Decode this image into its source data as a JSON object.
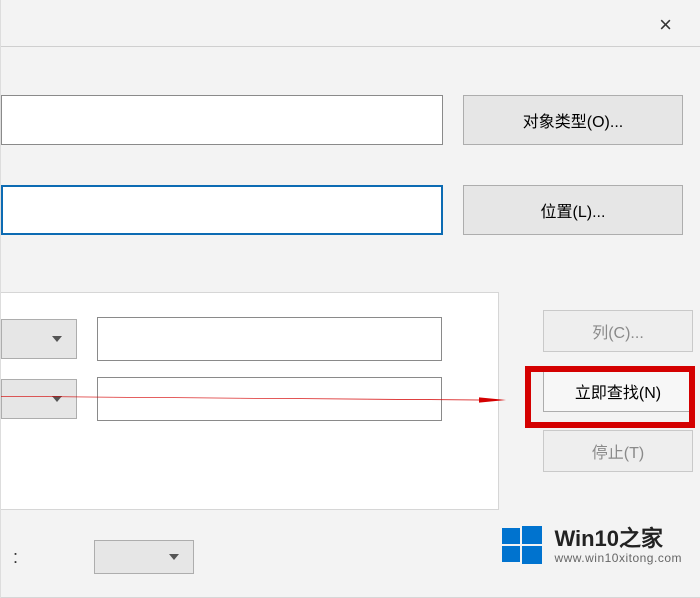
{
  "close_label": "×",
  "top_buttons": {
    "object_types": "对象类型(O)...",
    "location": "位置(L)..."
  },
  "side_buttons": {
    "columns": "列(C)...",
    "find_now": "立即查找(N)",
    "stop": "停止(T)"
  },
  "bottom": {
    "colon": ":"
  },
  "watermark": {
    "title": "Win10之家",
    "url": "www.win10xitong.com"
  }
}
